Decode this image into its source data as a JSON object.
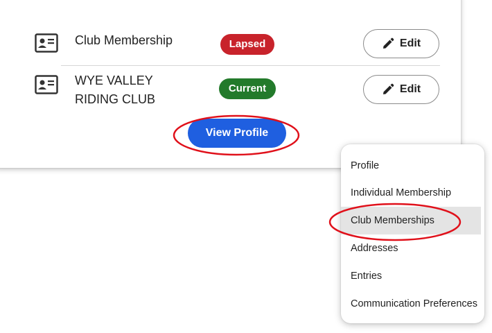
{
  "memberships": [
    {
      "name_line1": "Club Membership",
      "name_line2": "",
      "status": "Lapsed",
      "status_color": "#c8232b",
      "edit_label": "Edit"
    },
    {
      "name_line1": "WYE VALLEY",
      "name_line2": "RIDING CLUB",
      "status": "Current",
      "status_color": "#237a2b",
      "edit_label": "Edit"
    }
  ],
  "view_profile_label": "View Profile",
  "accent_color": "#1f5fe0",
  "highlight_color": "#e0101a",
  "menu": {
    "items": [
      "Profile",
      "Individual Membership",
      "Club Memberships",
      "Addresses",
      "Entries",
      "Communication Preferences"
    ],
    "selected": "Club Memberships"
  },
  "icons": [
    "id-card-icon",
    "pencil-icon"
  ]
}
